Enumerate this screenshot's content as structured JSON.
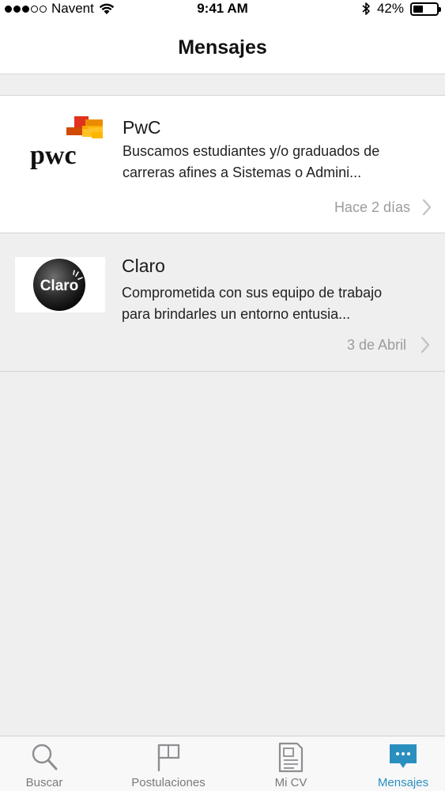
{
  "status_bar": {
    "carrier": "Navent",
    "time": "9:41 AM",
    "battery": "42%",
    "battery_level": 0.42
  },
  "header": {
    "title": "Mensajes"
  },
  "messages": [
    {
      "sender": "PwC",
      "preview_line1": "Buscamos estudiantes y/o graduados de",
      "preview_line2": "carreras afines a Sistemas o Admini...",
      "date": "Hace 2 días",
      "logo_text": "pwc",
      "read": false
    },
    {
      "sender": "Claro",
      "preview_line1": "Comprometida con sus equipo de trabajo",
      "preview_line2": "para brindarles un entorno entusia...",
      "date": "3 de Abril",
      "logo_text": "Claro",
      "read": true
    }
  ],
  "tabs": [
    {
      "label": "Buscar",
      "icon": "search-icon",
      "active": false
    },
    {
      "label": "Postulaciones",
      "icon": "flag-icon",
      "active": false
    },
    {
      "label": "Mi CV",
      "icon": "document-icon",
      "active": false
    },
    {
      "label": "Mensajes",
      "icon": "chat-bubble-icon",
      "active": true
    }
  ],
  "colors": {
    "accent": "#2a8fbf",
    "pwc_orange": "#e0301e",
    "pwc_yellow": "#ffb600",
    "date_grey": "#9c9ca0",
    "background": "#efeff0"
  }
}
